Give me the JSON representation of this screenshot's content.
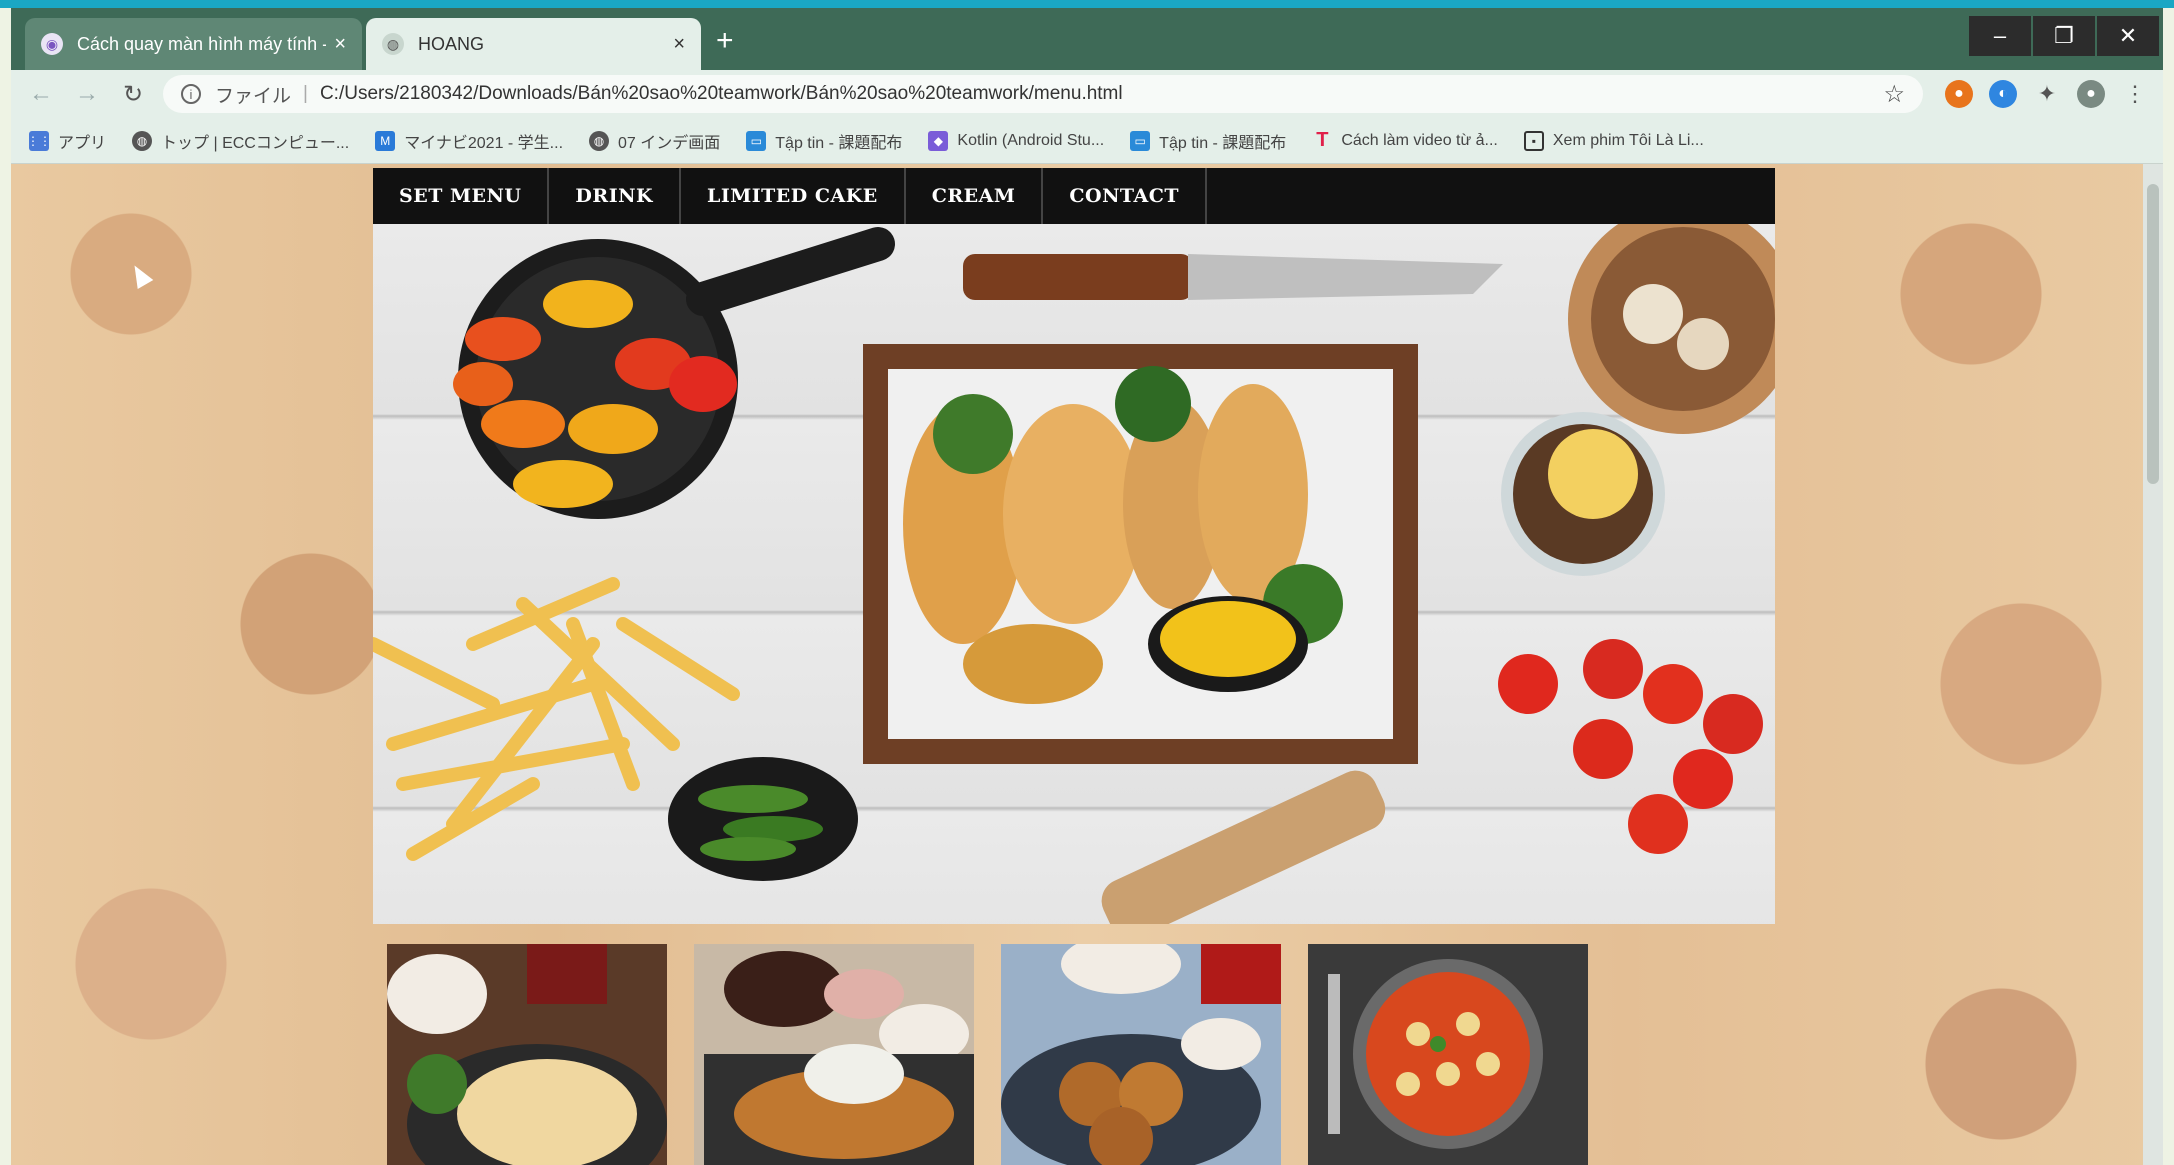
{
  "browser": {
    "tabs": [
      {
        "title": "Cách quay màn hình máy tính - ("
      },
      {
        "title": "HOANG"
      }
    ],
    "new_tab_symbol": "+",
    "tab_close_symbol": "×",
    "window_controls": {
      "minimize": "–",
      "restore": "❐",
      "close": "✕"
    },
    "nav": {
      "back": "←",
      "forward": "→",
      "reload": "↻"
    },
    "address": {
      "scheme_label": "ファイル",
      "separator": "|",
      "url": "C:/Users/2180342/Downloads/Bán%20sao%20teamwork/Bán%20sao%20teamwork/menu.html",
      "star": "☆"
    },
    "bookmarks": [
      {
        "label": "アプリ",
        "icon": "apps-grid-icon",
        "color": "#4a7bd8"
      },
      {
        "label": "トップ | ECCコンピュー...",
        "icon": "globe-icon",
        "color": "#555555"
      },
      {
        "label": "マイナビ2021 - 学生...",
        "icon": "mynavi-icon",
        "color": "#2a7ad8"
      },
      {
        "label": "07 インデ画面",
        "icon": "globe-icon",
        "color": "#555555"
      },
      {
        "label": "Tập tin - 課題配布",
        "icon": "classroom-icon",
        "color": "#2a8ad8"
      },
      {
        "label": "Kotlin (Android Stu...",
        "icon": "kotlin-icon",
        "color": "#7a5cd8"
      },
      {
        "label": "Tập tin - 課題配布",
        "icon": "classroom-icon",
        "color": "#2a8ad8"
      },
      {
        "label": "Cách làm video từ ả...",
        "icon": "t-logo-icon",
        "color": "#e0204a"
      },
      {
        "label": "Xem phim Tôi Là Li...",
        "icon": "tv-icon",
        "color": "#333333"
      }
    ]
  },
  "site": {
    "nav": [
      {
        "label": "SET MENU"
      },
      {
        "label": "DRINK"
      },
      {
        "label": "LIMITED CAKE"
      },
      {
        "label": "CREAM"
      },
      {
        "label": "CONTACT"
      }
    ],
    "hero_image": "food-flatlay-image",
    "thumbnails": [
      "fried-chicken-dish-image",
      "tonkatsu-set-image",
      "croquette-set-image",
      "gnocchi-pan-image"
    ]
  }
}
